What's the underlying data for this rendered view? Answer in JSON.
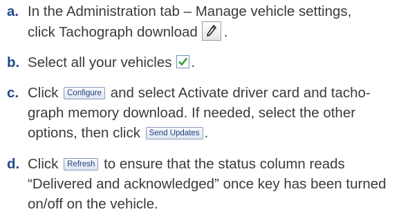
{
  "steps": [
    {
      "letter": "a.",
      "lines": [
        "In the Administration tab – Manage vehicle settings,",
        "click Tachograph download",
        "."
      ],
      "icon": "pencil-icon"
    },
    {
      "letter": "b.",
      "lines": [
        "Select all your vehicles",
        "."
      ],
      "icon": "checkbox-checked-icon"
    },
    {
      "letter": "c.",
      "lines": [
        "Click",
        "and select Activate driver card and tacho-",
        "graph memory download. If needed, select the other",
        "options, then click",
        "."
      ],
      "buttons": [
        "Configure",
        "Send Updates"
      ]
    },
    {
      "letter": "d.",
      "lines": [
        "Click",
        "to ensure that the status column reads",
        "“Delivered and acknowledged” once key has been turned",
        "on/off on the vehicle."
      ],
      "buttons": [
        "Refresh"
      ]
    }
  ],
  "colors": {
    "letter": "#1e4a8a",
    "text": "#3a3a3a",
    "button_text": "#1f3f78",
    "checkmark": "#2ea02e"
  }
}
